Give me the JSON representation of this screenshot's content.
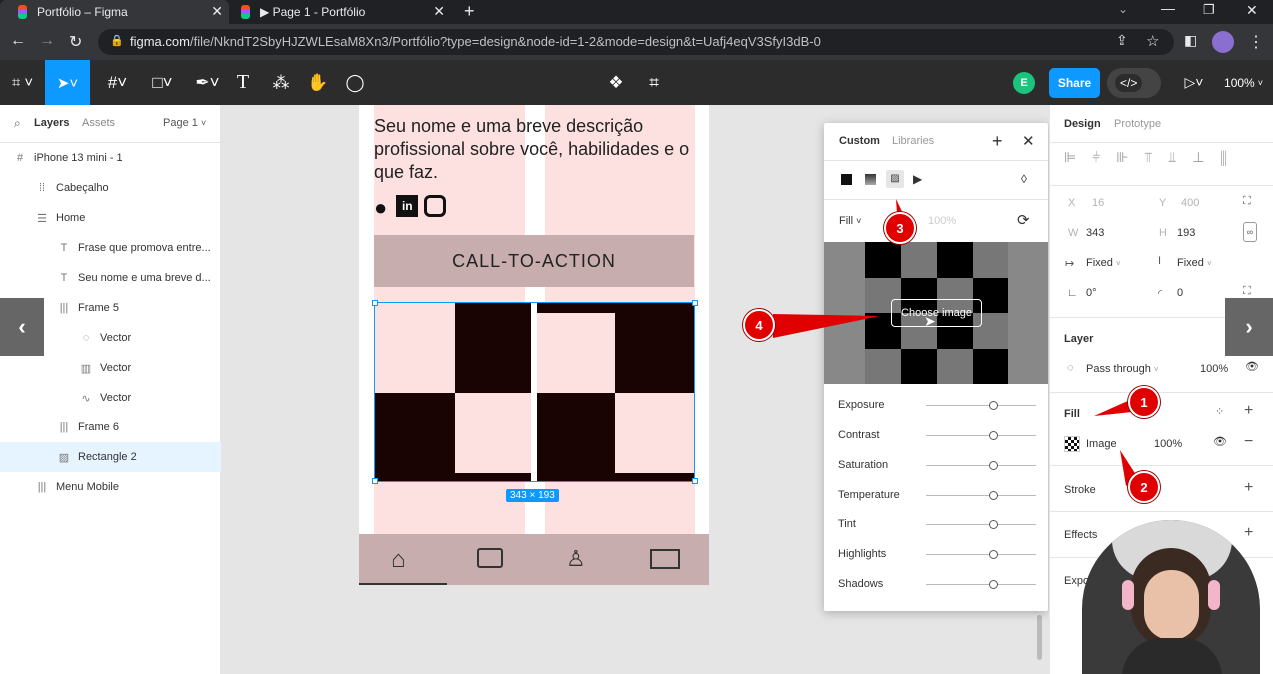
{
  "browser": {
    "tabs": [
      {
        "title": "Portfólio – Figma"
      },
      {
        "title": "▶ Page 1 - Portfólio"
      }
    ],
    "url_host": "figma.com",
    "url_path": "/file/NkndT2SbyHJZWLEsaM8Xn3/Portfólio?type=design&node-id=1-2&mode=design&t=Uafj4eqV3SfyI3dB-0"
  },
  "toolbar": {
    "avatar_letter": "E",
    "share_label": "Share",
    "zoom": "100%"
  },
  "left_panel": {
    "tabs": {
      "layers": "Layers",
      "assets": "Assets",
      "page": "Page 1"
    },
    "layers": [
      {
        "label": "iPhone 13 mini - 1",
        "icon": "frame-icon"
      },
      {
        "label": "Cabeçalho",
        "icon": "auto-layout-icon"
      },
      {
        "label": "Home",
        "icon": "auto-layout-icon"
      },
      {
        "label": "Frase que promova entre...",
        "icon": "text-icon"
      },
      {
        "label": "Seu nome e uma breve d...",
        "icon": "text-icon"
      },
      {
        "label": "Frame 5",
        "icon": "auto-layout-icon"
      },
      {
        "label": "Vector",
        "icon": "vector-icon"
      },
      {
        "label": "Vector",
        "icon": "vector-icon"
      },
      {
        "label": "Vector",
        "icon": "vector-icon"
      },
      {
        "label": "Frame 6",
        "icon": "auto-layout-icon"
      },
      {
        "label": "Rectangle 2",
        "icon": "image-icon"
      },
      {
        "label": "Menu Mobile",
        "icon": "auto-layout-icon"
      }
    ]
  },
  "canvas": {
    "description": "Seu nome e uma breve descrição profissional sobre você, habilidades e o que faz.",
    "cta": "CALL-TO-ACTION",
    "dimensions": "343 × 193"
  },
  "popup": {
    "tabs": {
      "custom": "Custom",
      "libraries": "Libraries"
    },
    "fill_mode": "Fill",
    "opacity": "100%",
    "choose_image": "Choose image",
    "adjustments": [
      "Exposure",
      "Contrast",
      "Saturation",
      "Temperature",
      "Tint",
      "Highlights",
      "Shadows"
    ]
  },
  "right_panel": {
    "tabs": {
      "design": "Design",
      "prototype": "Prototype"
    },
    "x_label": "X",
    "x": "16",
    "y_label": "Y",
    "y": "400",
    "w_label": "W",
    "w": "343",
    "h_label": "H",
    "h": "193",
    "w_mode": "Fixed",
    "h_mode": "Fixed",
    "rotation": "0°",
    "radius": "0",
    "layer_title": "Layer",
    "blend": "Pass through",
    "layer_opacity": "100%",
    "fill_title": "Fill",
    "fill_type": "Image",
    "fill_opacity": "100%",
    "stroke_title": "Stroke",
    "effects_title": "Effects",
    "export_title": "Expo"
  },
  "annotations": {
    "one": "1",
    "two": "2",
    "three": "3",
    "four": "4"
  },
  "colors": {
    "accent": "#0d99ff",
    "annotation": "#e00000",
    "dark": "#2c2c2c",
    "pink": "#fde0e0"
  }
}
